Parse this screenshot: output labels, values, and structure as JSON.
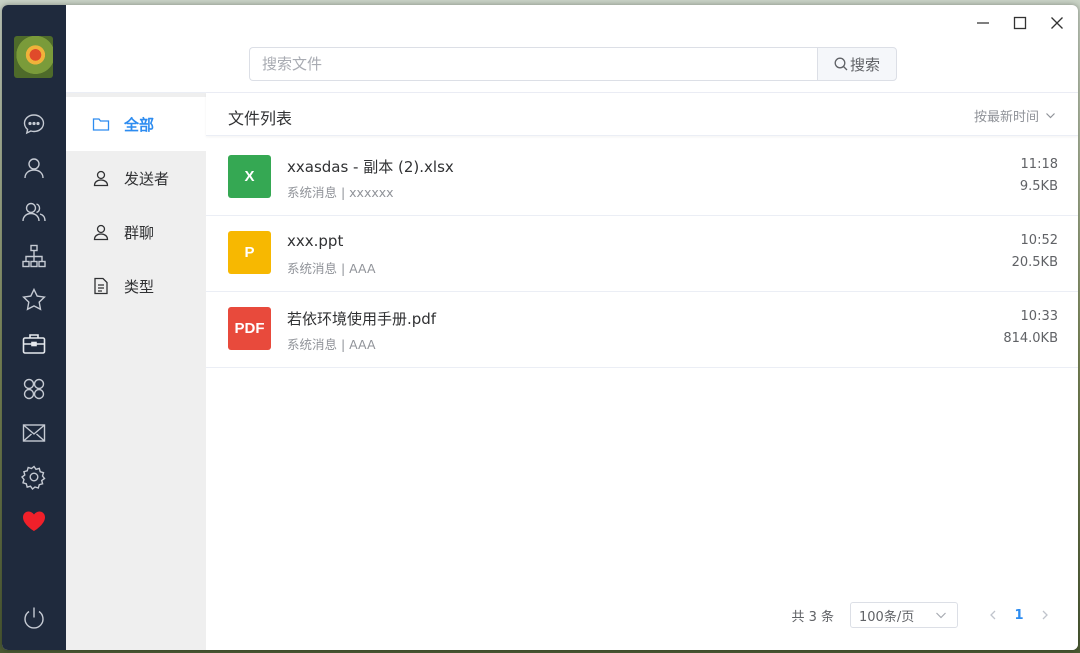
{
  "window": {
    "controls": [
      "minimize",
      "maximize",
      "close"
    ]
  },
  "rail": {
    "icons": [
      "chat-icon",
      "user-icon",
      "users-icon",
      "org-chart-icon",
      "star-icon",
      "briefcase-icon",
      "apps-icon",
      "mail-icon",
      "gear-icon",
      "heart-icon",
      "power-icon"
    ],
    "heart_color": "#f0202a",
    "background": "#1f2a3d"
  },
  "search": {
    "placeholder": "搜索文件",
    "value": "",
    "button_label": "搜索"
  },
  "categories": [
    {
      "label": "全部",
      "icon": "folder-icon",
      "active": true
    },
    {
      "label": "发送者",
      "icon": "user-icon",
      "active": false
    },
    {
      "label": "群聊",
      "icon": "user-icon",
      "active": false
    },
    {
      "label": "类型",
      "icon": "document-icon",
      "active": false
    }
  ],
  "list": {
    "title": "文件列表",
    "sort_label": "按最新时间",
    "files": [
      {
        "badge": "X",
        "badge_color": "#35a853",
        "name": "xxasdas - 副本 (2).xlsx",
        "meta": "系统消息 | xxxxxx",
        "time": "11:18",
        "size": "9.5KB"
      },
      {
        "badge": "P",
        "badge_color": "#f7b801",
        "name": "xxx.ppt",
        "meta": "系统消息 | AAA",
        "time": "10:52",
        "size": "20.5KB"
      },
      {
        "badge": "PDF",
        "badge_color": "#e84a3c",
        "name": "若依环境使用手册.pdf",
        "meta": "系统消息 | AAA",
        "time": "10:33",
        "size": "814.0KB"
      }
    ]
  },
  "pagination": {
    "total_label": "共 3 条",
    "page_size": "100条/页",
    "current_page": "1"
  },
  "accent": "#2d8cf0"
}
